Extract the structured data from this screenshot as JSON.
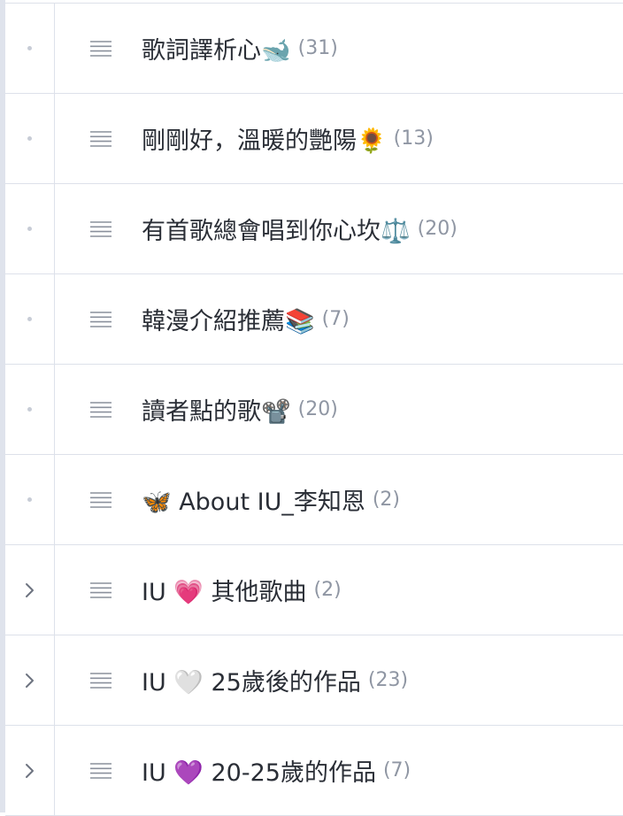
{
  "categories": [
    {
      "title": "歌詞譯析心🐋",
      "count": "(31)",
      "toggle": "dot"
    },
    {
      "title": "剛剛好，溫暖的艷陽🌻",
      "count": "(13)",
      "toggle": "dot"
    },
    {
      "title": "有首歌總會唱到你心坎⚖️",
      "count": "(20)",
      "toggle": "dot"
    },
    {
      "title": "韓漫介紹推薦📚",
      "count": "(7)",
      "toggle": "dot"
    },
    {
      "title": "讀者點的歌📽️",
      "count": "(20)",
      "toggle": "dot"
    },
    {
      "title": "🦋 About IU_李知恩",
      "count": "(2)",
      "toggle": "dot"
    },
    {
      "title": "IU 💗 其他歌曲",
      "count": "(2)",
      "toggle": "chevron"
    },
    {
      "title": "IU 🤍 25歲後的作品",
      "count": "(23)",
      "toggle": "chevron"
    },
    {
      "title": "IU 💜 20-25歲的作品",
      "count": "(7)",
      "toggle": "chevron"
    }
  ],
  "icons": {
    "dot": "bullet-dot-icon",
    "chevron": "chevron-right-icon",
    "handle": "drag-handle-icon"
  }
}
